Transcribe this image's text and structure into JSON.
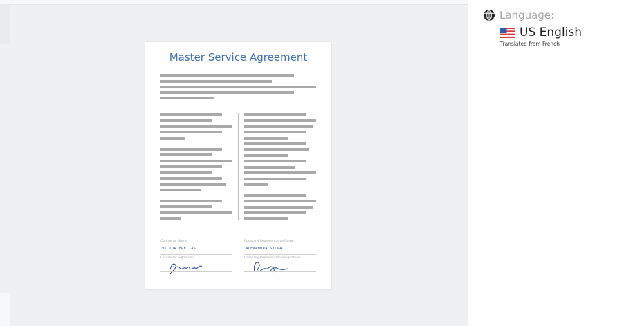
{
  "language_panel": {
    "label": "Language:",
    "value": "US English",
    "note": "Translated from French",
    "icons": {
      "globe": "globe-icon",
      "flag": "us-flag-icon"
    }
  },
  "document": {
    "title": "Master Service Agreement",
    "contractor_name_label": "Contractor Name",
    "contractor_name": "VICTOR FREITAS",
    "contractor_signature_label": "Contractor Signature",
    "company_rep_label": "Company Representative Name",
    "company_rep_name": "ALEXANDRA SILVA",
    "company_rep_signature_label": "Company Representative Signature"
  },
  "colors": {
    "title_blue": "#3f73b3",
    "signature_blue": "#2f4f9e",
    "text_bar_gray": "#a9a9a9",
    "left_pane_bg": "#eef0f2"
  }
}
